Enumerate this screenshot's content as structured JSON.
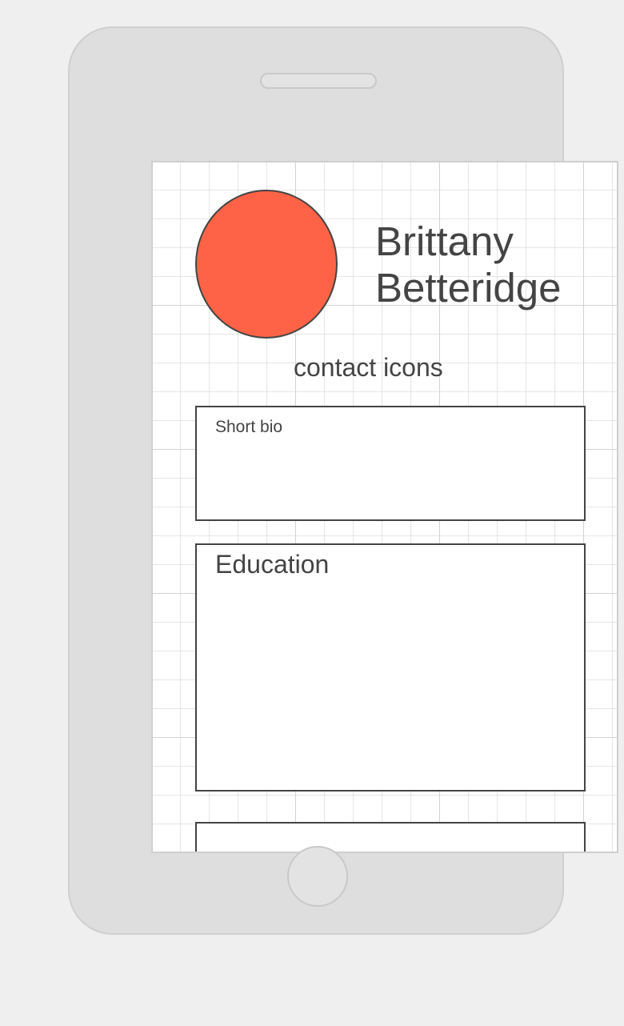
{
  "profile": {
    "name_line1": "Brittany",
    "name_line2": "Betteridge",
    "avatar_color": "#ff6347"
  },
  "contact": {
    "label": "contact icons"
  },
  "sections": {
    "bio_label": "Short bio",
    "education_label": "Education"
  },
  "colors": {
    "stroke": "#444444",
    "device": "#dedede",
    "background": "#efefef"
  }
}
